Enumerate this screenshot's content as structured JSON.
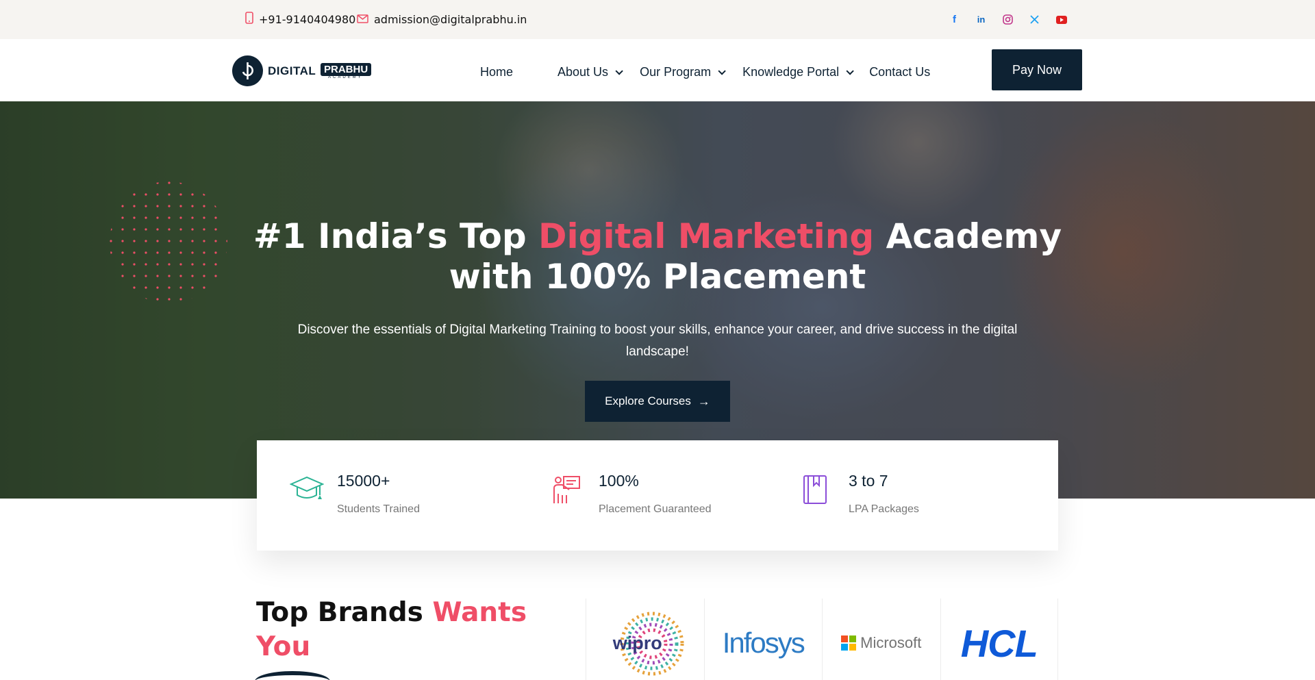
{
  "topbar": {
    "phone": "+91-9140404980",
    "email": "admission@digitalprabhu.in",
    "social": [
      "facebook-icon",
      "linkedin-icon",
      "instagram-icon",
      "x-icon",
      "youtube-icon"
    ]
  },
  "brand": {
    "word1": "DIGITAL",
    "word2": "PRABHU",
    "sub": "ACADEMY"
  },
  "nav": {
    "items": [
      {
        "label": "Home",
        "dropdown": false
      },
      {
        "label": "About Us",
        "dropdown": true
      },
      {
        "label": "Our Program",
        "dropdown": true
      },
      {
        "label": "Knowledge Portal",
        "dropdown": true
      },
      {
        "label": "Contact Us",
        "dropdown": false
      }
    ],
    "cta": "Pay Now"
  },
  "hero": {
    "title_part1": "#1 India’s Top ",
    "title_accent": "Digital Marketing",
    "title_part2": " Academy",
    "title_line2": "with 100% Placement",
    "subtitle": "Discover the essentials of Digital Marketing Training to boost your skills, enhance your career, and drive success in the digital landscape!",
    "button": "Explore Courses"
  },
  "stats": [
    {
      "value": "15000+",
      "label": "Students Trained",
      "icon": "graduation-cap-icon",
      "color": "#2bb394"
    },
    {
      "value": "100%",
      "label": "Placement Guaranteed",
      "icon": "teacher-board-icon",
      "color": "#ef4e67"
    },
    {
      "value": "3 to 7",
      "label": "LPA Packages",
      "icon": "book-icon",
      "color": "#8b4dd8"
    }
  ],
  "brands": {
    "title_part1": "Top Brands ",
    "title_accent": "Wants You",
    "logos": [
      "wipro",
      "Infosys",
      "Microsoft",
      "HCL"
    ]
  },
  "colors": {
    "navy": "#0e2233",
    "accent": "#ef4e67"
  }
}
